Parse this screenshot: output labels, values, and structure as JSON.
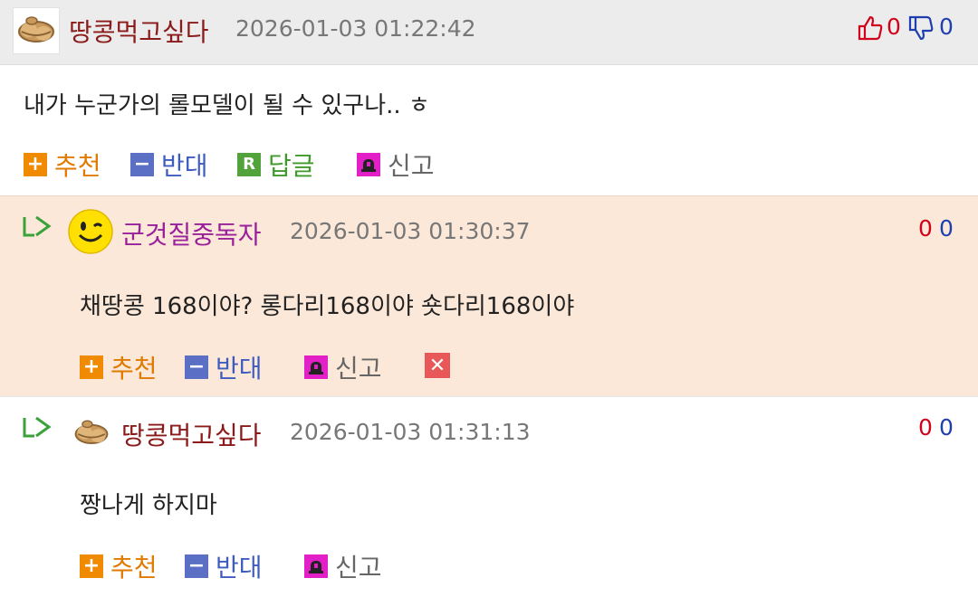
{
  "comments": [
    {
      "nickname": "땅콩먹고싶다",
      "date": "2026-01-03 01:22:42",
      "upvotes": "0",
      "downvotes": "0",
      "content": "내가 누군가의 롤모델이 될 수 있구나.. ㅎ",
      "actions": {
        "recommend": "추천",
        "oppose": "반대",
        "reply": "답글",
        "report": "신고"
      }
    },
    {
      "nickname": "군것질중독자",
      "date": "2026-01-03 01:30:37",
      "upvotes": "0",
      "downvotes": "0",
      "content": "채땅콩 168이야? 롱다리168이야 숏다리168이야",
      "actions": {
        "recommend": "추천",
        "oppose": "반대",
        "report": "신고"
      }
    },
    {
      "nickname": "땅콩먹고싶다",
      "date": "2026-01-03 01:31:13",
      "upvotes": "0",
      "downvotes": "0",
      "content": "짱나게 하지마",
      "actions": {
        "recommend": "추천",
        "oppose": "반대",
        "report": "신고"
      }
    }
  ],
  "icons": {
    "avatar_peanut": "peanut-icon",
    "avatar_smiley": "winking-smiley-icon",
    "thumbs_up": "thumbs-up-icon",
    "thumbs_down": "thumbs-down-icon",
    "reply_arrow": "reply-arrow-icon",
    "siren": "siren-icon",
    "delete": "close-icon"
  },
  "colors": {
    "header_bg": "#ececec",
    "reply_highlight_bg": "#fbe8d8",
    "nickname": "#8b1a1a",
    "nickname_highlight": "#9a1f9a",
    "upvote": "#d0021b",
    "downvote": "#1f3fae"
  }
}
